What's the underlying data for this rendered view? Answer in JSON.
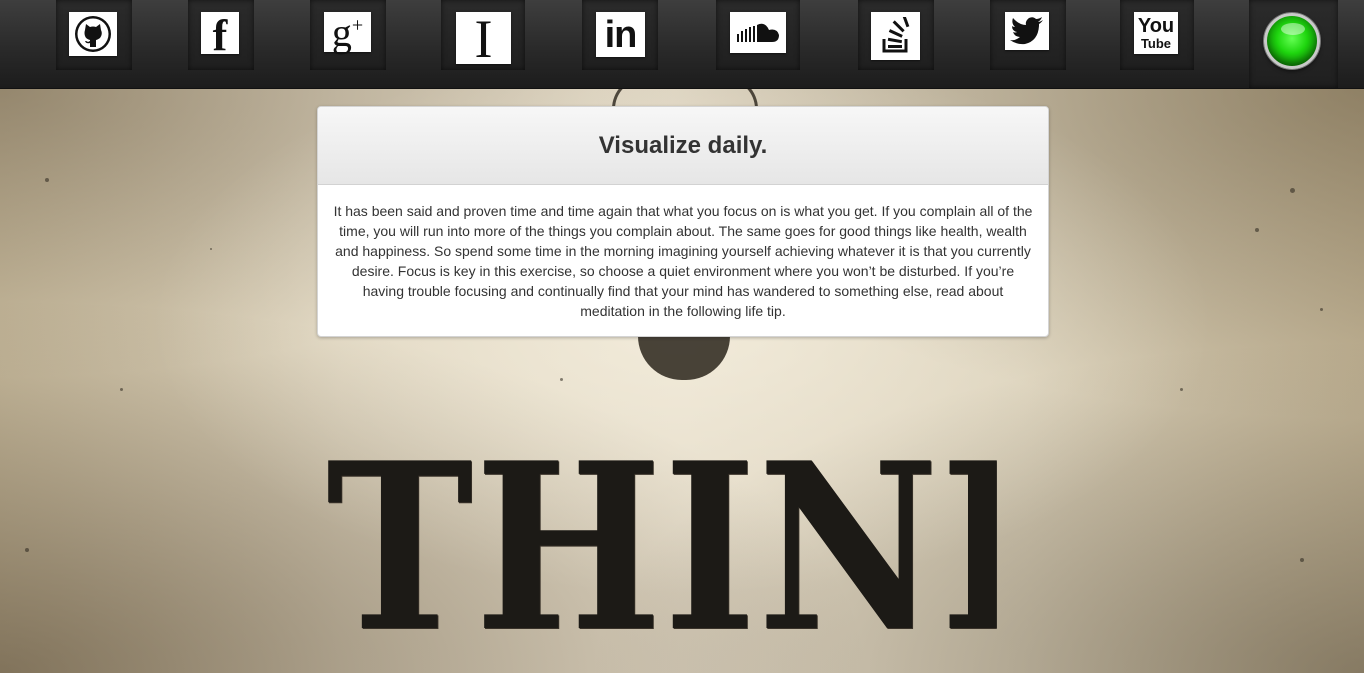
{
  "nav": {
    "icons": [
      {
        "name": "github-icon",
        "glyph": ""
      },
      {
        "name": "facebook-icon",
        "glyph": "f"
      },
      {
        "name": "google-plus-icon",
        "glyph": "g",
        "sup": "+"
      },
      {
        "name": "instapaper-icon",
        "glyph": "I"
      },
      {
        "name": "linkedin-icon",
        "glyph": "in"
      },
      {
        "name": "soundcloud-icon",
        "glyph": ""
      },
      {
        "name": "stackoverflow-icon",
        "glyph": ""
      },
      {
        "name": "twitter-icon",
        "glyph": ""
      },
      {
        "name": "youtube-icon",
        "line1": "You",
        "line2": "Tube"
      }
    ],
    "status_color": "#1fd60f"
  },
  "card": {
    "title": "Visualize daily.",
    "body": "It has been said and proven time and time again that what you focus on is what you get. If you complain all of the time, you will run into more of the things you complain about. The same goes for good things like health, wealth and happiness. So spend some time in the morning imagining yourself achieving whatever it is that you currently desire. Focus is key in this exercise, so choose a quiet environment where you won’t be disturbed. If you’re having trouble focusing and continually find that your mind has wandered to something else, read about meditation in the following life tip."
  },
  "poster": {
    "headline": "THINK !"
  }
}
